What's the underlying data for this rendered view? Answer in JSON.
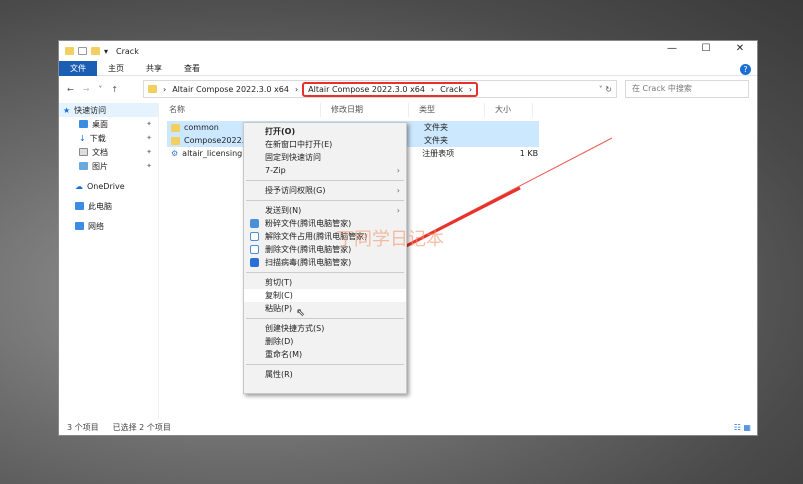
{
  "window": {
    "title": "Crack",
    "controls": [
      "—",
      "☐",
      "✕"
    ]
  },
  "ribbon": {
    "tabs": [
      "文件",
      "主页",
      "共享",
      "查看"
    ],
    "help": "?"
  },
  "address": {
    "crumbs": [
      "Altair Compose 2022.3.0 x64",
      "Altair Compose 2022.3.0 x64",
      "Crack"
    ],
    "search_placeholder": "在 Crack 中搜索"
  },
  "sidebar": {
    "items": [
      {
        "label": "快速访问"
      },
      {
        "label": "桌面"
      },
      {
        "label": "下载"
      },
      {
        "label": "文档"
      },
      {
        "label": "图片"
      },
      {
        "label": "OneDrive"
      },
      {
        "label": "此电脑"
      },
      {
        "label": "网络"
      }
    ]
  },
  "columns": [
    "名称",
    "修改日期",
    "类型",
    "大小"
  ],
  "files": [
    {
      "name": "common",
      "type": "文件夹",
      "size": ""
    },
    {
      "name": "Compose2022.3",
      "type": "文件夹",
      "size": ""
    },
    {
      "name": "altair_licensing",
      "type": "注册表项",
      "size": "1 KB"
    }
  ],
  "status": {
    "count": "3 个项目",
    "selected": "已选择 2 个项目"
  },
  "context_menu": {
    "items": [
      "打开(O)",
      "在新窗口中打开(E)",
      "固定到快速访问",
      "7-Zip",
      "授予访问权限(G)",
      "发送到(N)",
      "粉碎文件(腾讯电脑管家)",
      "解除文件占用(腾讯电脑管家)",
      "删除文件(腾讯电脑管家)",
      "扫描病毒(腾讯电脑管家)",
      "剪切(T)",
      "复制(C)",
      "粘贴(P)",
      "创建快捷方式(S)",
      "删除(D)",
      "重命名(M)",
      "属性(R)"
    ]
  },
  "watermark": "丁同学日记本",
  "colors": {
    "accent": "#1a5fb4",
    "highlight": "#e8312a",
    "selection": "#cce8ff"
  }
}
